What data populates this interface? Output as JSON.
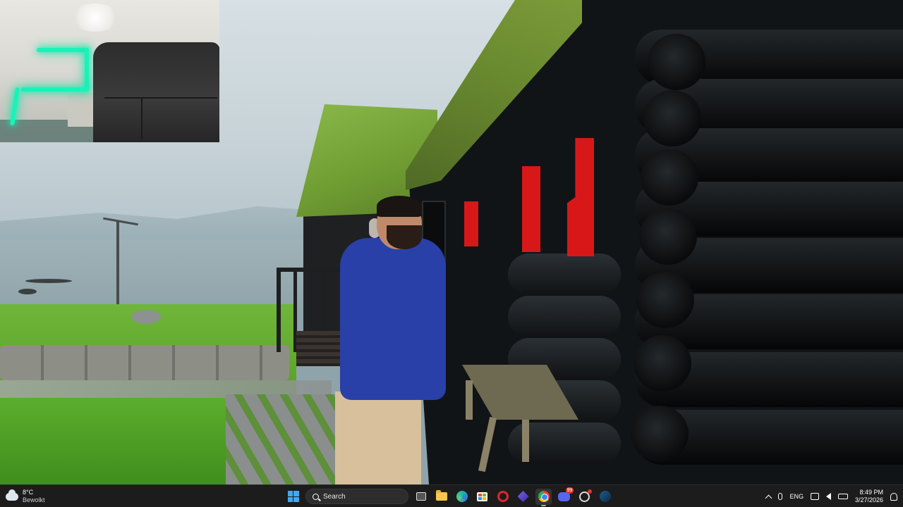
{
  "weather": {
    "temperature": "8°C",
    "condition": "Bewolkt",
    "icon": "cloud-icon"
  },
  "taskbar": {
    "search_label": "Search",
    "pinned_apps": [
      {
        "name": "start",
        "icon": "windows-logo-icon"
      },
      {
        "name": "search",
        "icon": "search-icon"
      },
      {
        "name": "task-view",
        "icon": "task-view-icon"
      },
      {
        "name": "file-explorer",
        "icon": "folder-icon"
      },
      {
        "name": "edge",
        "icon": "edge-icon"
      },
      {
        "name": "microsoft-store",
        "icon": "store-icon"
      },
      {
        "name": "opera",
        "icon": "opera-icon"
      },
      {
        "name": "proton-vpn",
        "icon": "proton-icon"
      },
      {
        "name": "chrome",
        "icon": "chrome-icon",
        "active": true
      },
      {
        "name": "discord",
        "icon": "discord-icon",
        "badge": "99"
      },
      {
        "name": "app-tool",
        "icon": "tool-icon"
      },
      {
        "name": "steam",
        "icon": "steam-icon"
      }
    ],
    "discord_badge": "99"
  },
  "tray": {
    "language": "ENG",
    "time": "8:49 PM",
    "date": "3/27/2026"
  },
  "colors": {
    "taskbar_bg": "#1c1c1c",
    "neon": "#19f3b8",
    "accent_blue": "#3fa9f5"
  }
}
